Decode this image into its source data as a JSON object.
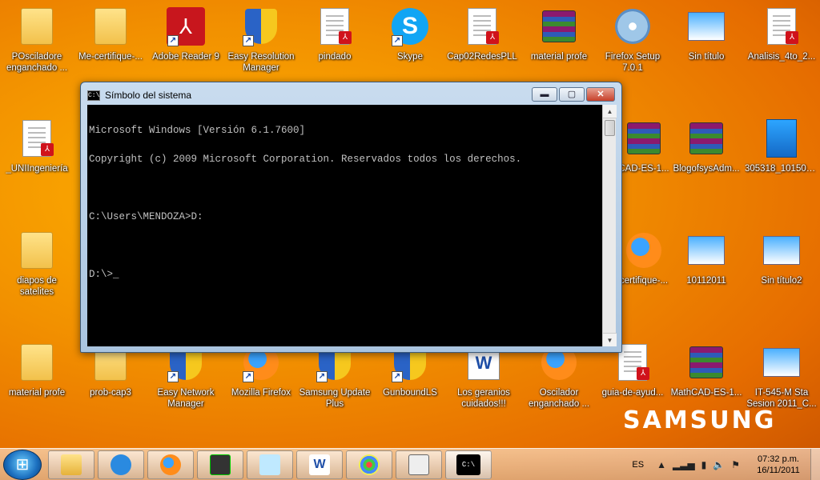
{
  "desktop_icons": {
    "row1": [
      {
        "label": "POsciladore enganchado ..."
      },
      {
        "label": "Me-certifique-..."
      },
      {
        "label": "Adobe Reader 9"
      },
      {
        "label": "Easy Resolution Manager"
      },
      {
        "label": "pindado"
      },
      {
        "label": "Skype"
      },
      {
        "label": "Cap02RedesPLL"
      },
      {
        "label": "material profe"
      },
      {
        "label": "Firefox Setup 7.0.1"
      },
      {
        "label": "Sin título"
      },
      {
        "label": "Analisis_4to_2..."
      }
    ],
    "row2": [
      {
        "label": "_UNIIngeniería"
      },
      {
        "label": "CAD-ES-1..."
      },
      {
        "label": "BlogofsysAdm..."
      },
      {
        "label": "305318_101503..."
      }
    ],
    "row3": [
      {
        "label": "diapos de satelites"
      },
      {
        "label": "certifique-..."
      },
      {
        "label": "10112011"
      },
      {
        "label": "Sin título2"
      }
    ],
    "row4": [
      {
        "label": "material profe"
      },
      {
        "label": "prob-cap3"
      },
      {
        "label": "Easy Network Manager"
      },
      {
        "label": "Mozilla Firefox"
      },
      {
        "label": "Samsung Update Plus"
      },
      {
        "label": "GunboundLS"
      },
      {
        "label": "Los geranios cuidados!!!"
      },
      {
        "label": "Oscilador enganchado ..."
      },
      {
        "label": "guia-de-ayud..."
      },
      {
        "label": "MathCAD-ES-1..."
      },
      {
        "label": "IT-545-M Sta Sesion 2011_C..."
      }
    ]
  },
  "cmd_window": {
    "title": "Símbolo del sistema",
    "icon_text": "C:\\",
    "minimize": "▬",
    "maximize": "▢",
    "close": "✕",
    "lines": [
      "Microsoft Windows [Versión 6.1.7600]",
      "Copyright (c) 2009 Microsoft Corporation. Reservados todos los derechos.",
      "",
      "C:\\Users\\MENDOZA>D:",
      "",
      "D:\\>_"
    ]
  },
  "brand": "SAMSUNG",
  "taskbar": {
    "language": "ES",
    "time": "07:32 p.m.",
    "date": "16/11/2011",
    "tray_icons": [
      "chevron-up-icon",
      "signal-icon",
      "battery-icon",
      "speaker-icon",
      "flag-icon"
    ]
  }
}
